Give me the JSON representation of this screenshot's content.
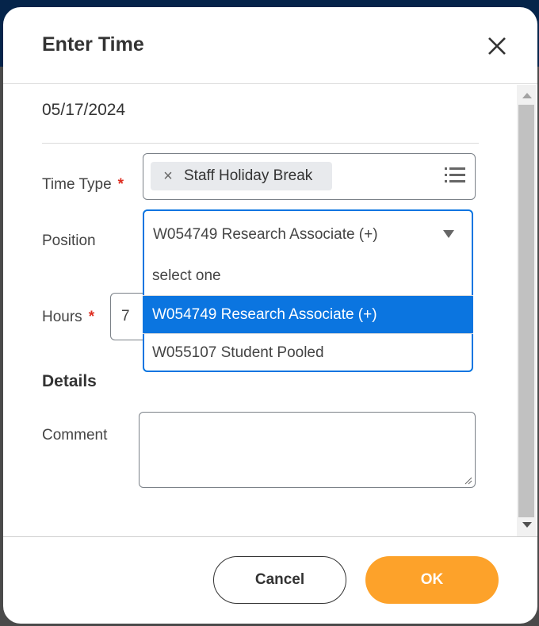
{
  "dialog": {
    "title": "Enter Time",
    "close_icon": "close-icon",
    "date": "05/17/2024"
  },
  "form": {
    "time_type": {
      "label": "Time Type",
      "required_marker": "*",
      "chip_value": "Staff Holiday Break",
      "chip_remove_icon": "×",
      "list_icon": "list-icon"
    },
    "position": {
      "label": "Position",
      "selected_value": "W054749 Research Associate (+)",
      "options": [
        {
          "label": "select one",
          "selected": false
        },
        {
          "label": "W054749 Research Associate (+)",
          "selected": true
        },
        {
          "label": "W055107 Student Pooled",
          "selected": false
        }
      ]
    },
    "hours": {
      "label": "Hours",
      "required_marker": "*",
      "value": "7"
    },
    "details_heading": "Details",
    "comment": {
      "label": "Comment",
      "value": ""
    }
  },
  "footer": {
    "cancel_label": "Cancel",
    "ok_label": "OK"
  },
  "colors": {
    "accent": "#0b75e0",
    "primary_button": "#fda22a",
    "required": "#de2e21",
    "header_bg": "#05244a"
  }
}
